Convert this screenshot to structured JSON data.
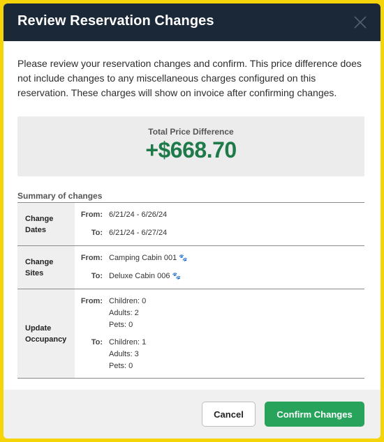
{
  "modal": {
    "title": "Review Reservation Changes",
    "intro": "Please review your reservation changes and confirm. This price difference does not include changes to any miscellaneous charges configured on this reservation. These charges will show on invoice after confirming changes."
  },
  "price": {
    "label": "Total Price Difference",
    "value": "+$668.70"
  },
  "summary": {
    "title": "Summary of changes",
    "from_label": "From:",
    "to_label": "To:",
    "dates": {
      "label_line1": "Change",
      "label_line2": "Dates",
      "from": "6/21/24 - 6/26/24",
      "to": "6/21/24 - 6/27/24"
    },
    "sites": {
      "label_line1": "Change",
      "label_line2": "Sites",
      "from": "Camping Cabin 001",
      "to": "Deluxe Cabin 006",
      "paw_icon": "paw-icon"
    },
    "occupancy": {
      "label_line1": "Update",
      "label_line2": "Occupancy",
      "from": [
        "Children: 0",
        "Adults: 2",
        "Pets: 0"
      ],
      "to": [
        "Children: 1",
        "Adults: 3",
        "Pets: 0"
      ]
    }
  },
  "footer": {
    "cancel_label": "Cancel",
    "confirm_label": "Confirm Changes"
  },
  "colors": {
    "header_bg": "#1b2838",
    "price_green": "#1f7a4a",
    "confirm_green": "#27a35b",
    "frame_yellow": "#f6d40a"
  }
}
